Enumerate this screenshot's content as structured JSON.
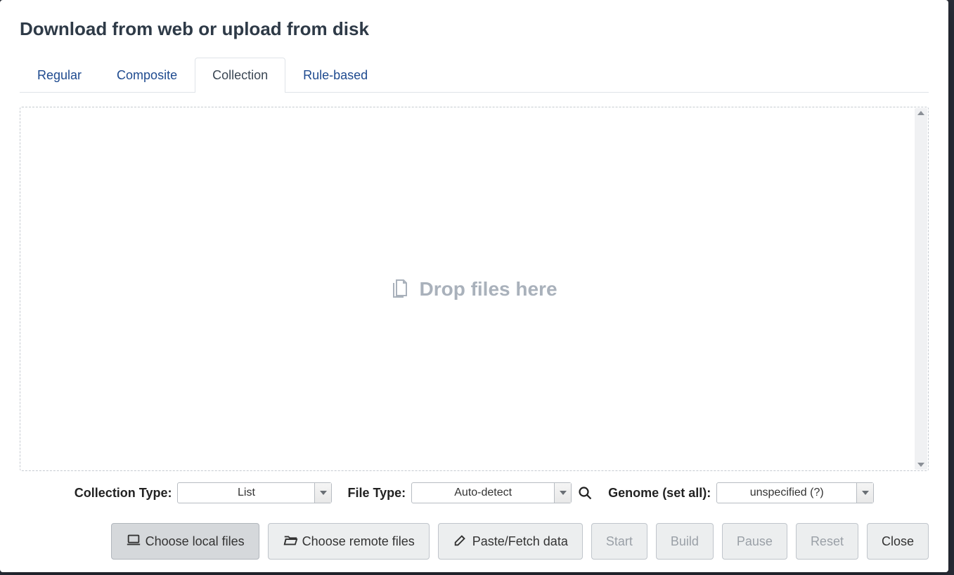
{
  "title": "Download from web or upload from disk",
  "tabs": [
    {
      "label": "Regular"
    },
    {
      "label": "Composite"
    },
    {
      "label": "Collection"
    },
    {
      "label": "Rule-based"
    }
  ],
  "active_tab": "Collection",
  "dropzone": {
    "text": "Drop files here"
  },
  "controls": {
    "collection_type": {
      "label": "Collection Type:",
      "value": "List"
    },
    "file_type": {
      "label": "File Type:",
      "value": "Auto-detect"
    },
    "genome": {
      "label": "Genome (set all):",
      "value": "unspecified (?)"
    }
  },
  "buttons": {
    "choose_local": "Choose local files",
    "choose_remote": "Choose remote files",
    "paste_fetch": "Paste/Fetch data",
    "start": "Start",
    "build": "Build",
    "pause": "Pause",
    "reset": "Reset",
    "close": "Close"
  }
}
